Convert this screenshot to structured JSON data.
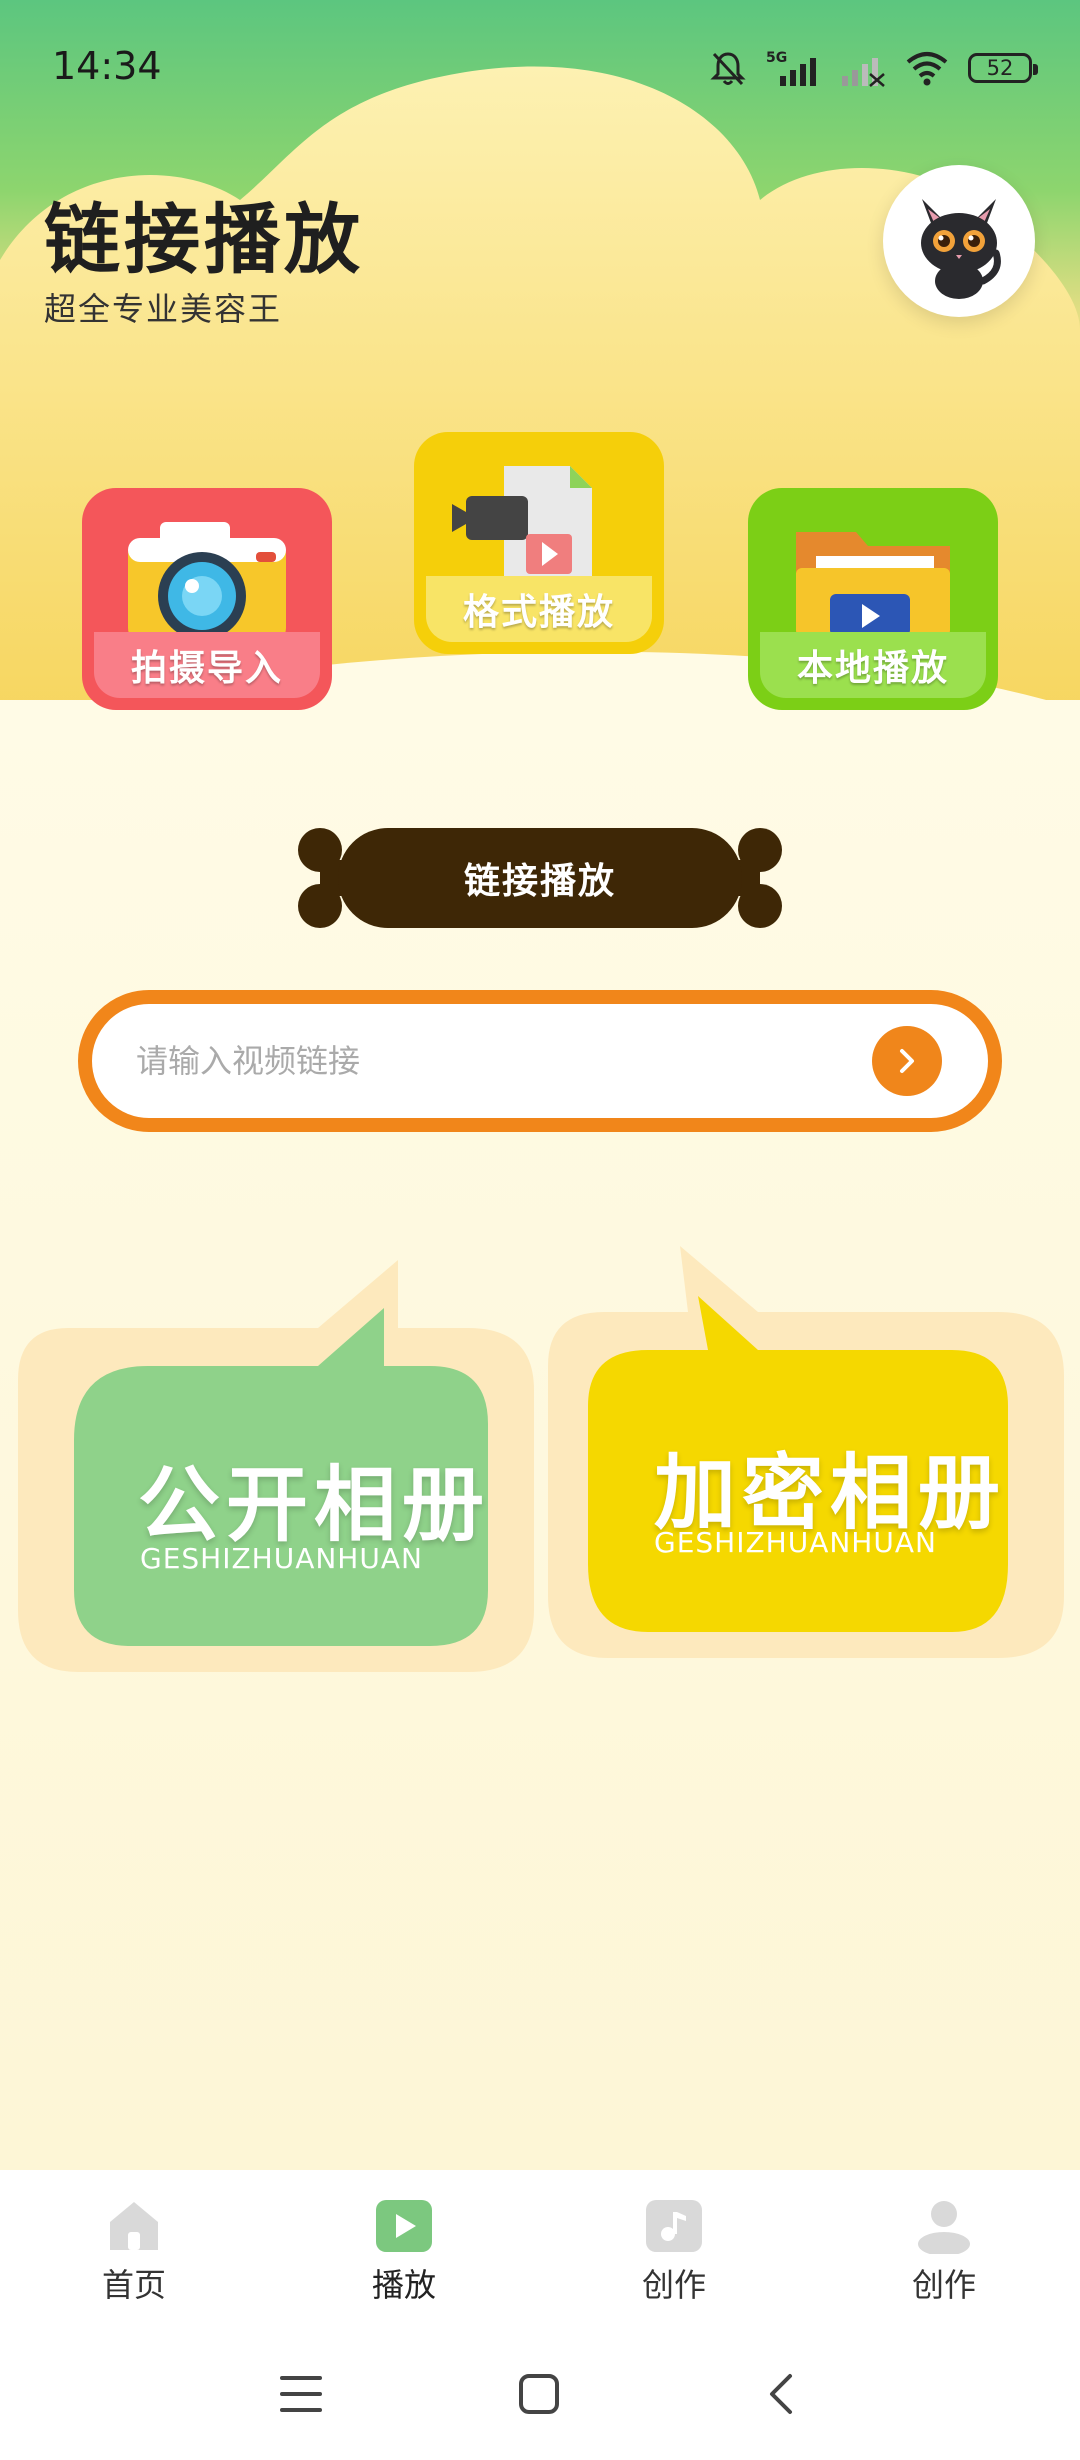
{
  "status_bar": {
    "time": "14:34",
    "battery": "52",
    "network": "5G"
  },
  "header": {
    "title": "链接播放",
    "subtitle": "超全专业美容王"
  },
  "features": [
    {
      "label": "拍摄导入"
    },
    {
      "label": "格式播放"
    },
    {
      "label": "本地播放"
    }
  ],
  "ribbon": {
    "label": "链接播放"
  },
  "search": {
    "placeholder": "请输入视频链接"
  },
  "albums": [
    {
      "title": "公开相册",
      "subtitle": "GESHIZHUANHUAN"
    },
    {
      "title": "加密相册",
      "subtitle": "GESHIZHUANHUAN"
    }
  ],
  "bottom_nav": [
    {
      "label": "首页",
      "icon": "home-icon",
      "active": false
    },
    {
      "label": "播放",
      "icon": "play-icon",
      "active": true
    },
    {
      "label": "创作",
      "icon": "music-note-icon",
      "active": false
    },
    {
      "label": "创作",
      "icon": "user-icon",
      "active": false
    }
  ],
  "colors": {
    "accent": "#f1861a",
    "green": "#8fd28a",
    "yellow": "#f5d800",
    "nav_active": "#7cc87f"
  }
}
